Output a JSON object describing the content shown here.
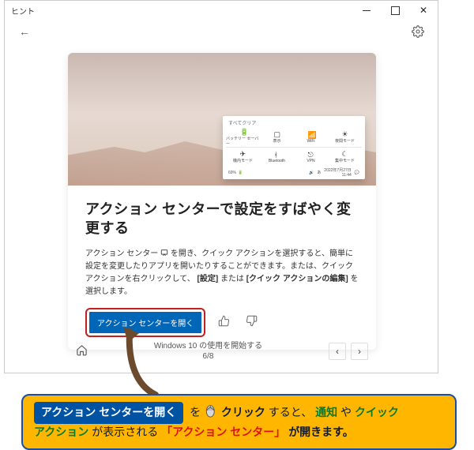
{
  "window": {
    "title": "ヒント"
  },
  "card": {
    "heading": "アクション センターで設定をすばやく変更する",
    "desc_prefix": "アクション センター",
    "desc_mid1": " を開き、クイック アクションを選択すると、簡単に設定を変更したりアプリを開いたりすることができます。または、クイック アクションを右クリックして、",
    "bold1": "[設定]",
    "mid2": " または ",
    "bold2": "[クイック アクションの編集]",
    "desc_suffix": " を選択します。",
    "cta": "アクション センターを開く"
  },
  "mini_panel": {
    "row1": [
      "バッテリー\nセーバー",
      "表示",
      "WiFi",
      "夜間モード"
    ],
    "row2": [
      "機内モード",
      "Bluetooth",
      "VPN",
      "集中モード"
    ],
    "footer_date": "2022年7月27日\n11:44"
  },
  "footer": {
    "title": "Windows 10 の使用を開始する",
    "page": "6/8"
  },
  "callout": {
    "pill": "アクション センターを開く",
    "t1": " を ",
    "t2": " クリック",
    "t3": "すると、",
    "g1": "通知",
    "t4": "や",
    "g2": "クイック",
    "g3": "アクション",
    "t5": "が表示される",
    "r1": "「アクション センター」",
    "t6": "が開きます。"
  }
}
